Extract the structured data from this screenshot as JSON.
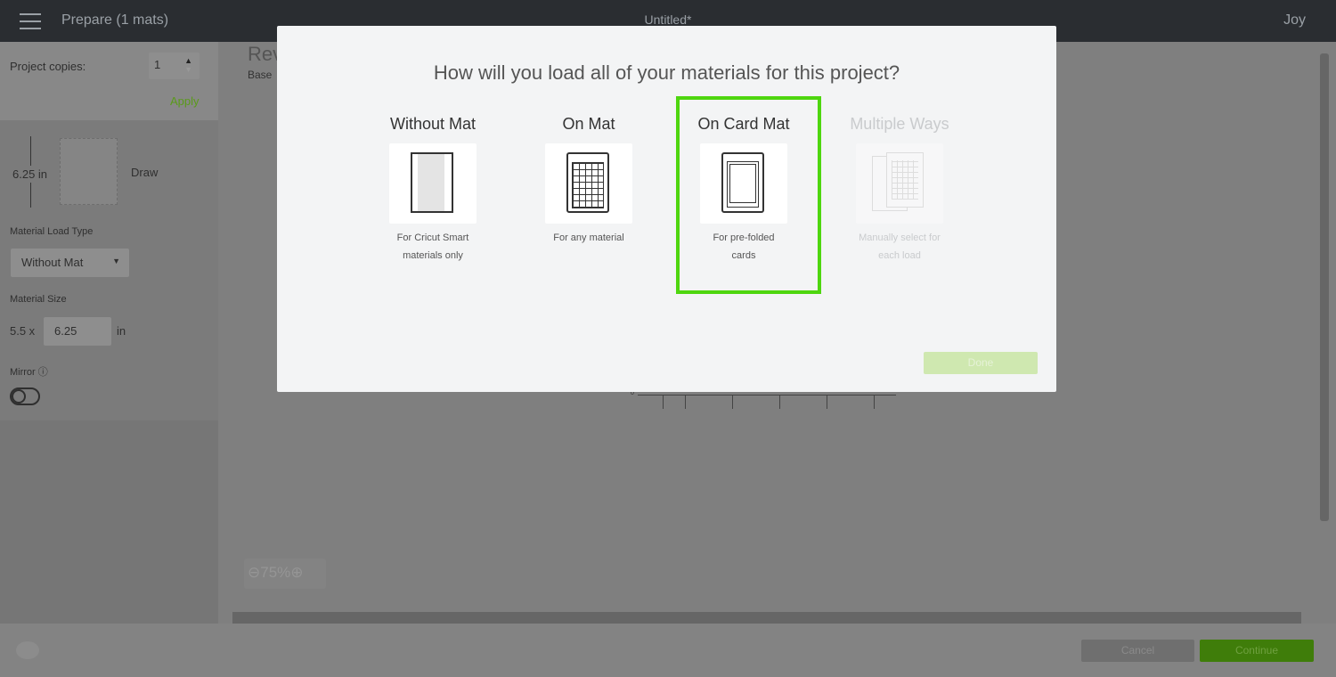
{
  "header": {
    "title": "Prepare (1 mats)",
    "document": "Untitled*",
    "user": "Joy"
  },
  "sidebar": {
    "copies_label": "Project copies:",
    "copies_value": "1",
    "apply": "Apply",
    "mat_height": "6.25 in",
    "mat_action": "Draw",
    "load_type_label": "Material Load Type",
    "load_type_value": "Without Mat",
    "size_label": "Material Size",
    "size_width": "5.5 x",
    "size_height": "6.25",
    "size_unit": "in",
    "mirror_label": "Mirror",
    "mirror_on": false
  },
  "canvas": {
    "title_partial": "Rev",
    "subtitle_partial": "Base",
    "ruler_zero": "0",
    "zoom": "75%"
  },
  "modal": {
    "title": "How will you load all of your materials for this project?",
    "options": [
      {
        "name": "Without Mat",
        "desc1": "For Cricut Smart",
        "desc2": "materials only",
        "icon": "no-mat-icon",
        "enabled": true
      },
      {
        "name": "On Mat",
        "desc1": "For any material",
        "desc2": "",
        "icon": "mat-grid-icon",
        "enabled": true
      },
      {
        "name": "On Card Mat",
        "desc1": "For pre-folded",
        "desc2": "cards",
        "icon": "card-mat-icon",
        "enabled": true,
        "selected": true
      },
      {
        "name": "Multiple Ways",
        "desc1": "Manually select for",
        "desc2": "each load",
        "icon": "multiple-mats-icon",
        "enabled": false
      }
    ],
    "done": "Done"
  },
  "footer": {
    "cancel": "Cancel",
    "continue": "Continue"
  },
  "colors": {
    "selection": "#4ed60f",
    "continue": "#3f7d0a",
    "apply": "#5a9a1a"
  }
}
